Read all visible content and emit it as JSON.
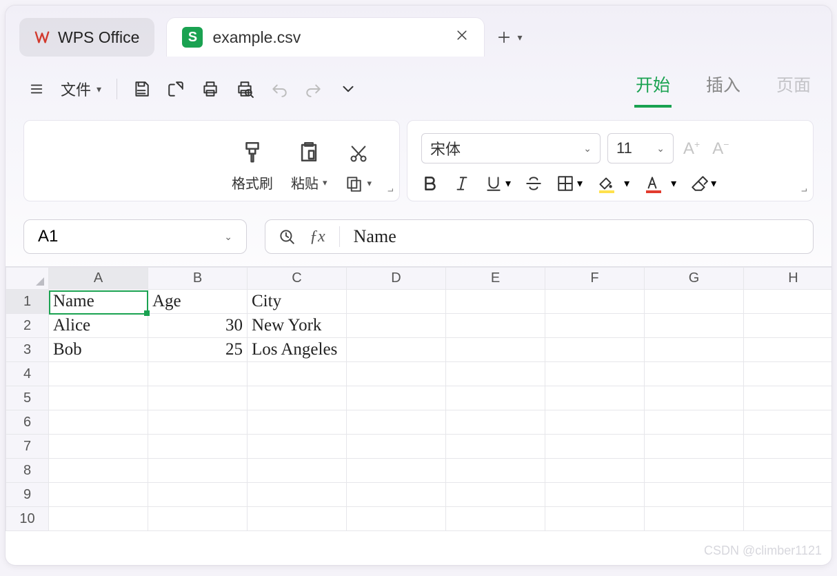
{
  "app": {
    "name": "WPS Office"
  },
  "tab": {
    "type_letter": "S",
    "filename": "example.csv"
  },
  "menu": {
    "file_label": "文件"
  },
  "ribbon_tabs": {
    "start": "开始",
    "insert": "插入",
    "page": "页面",
    "active": "start"
  },
  "ribbon": {
    "format_painter": "格式刷",
    "paste": "粘贴",
    "font_name": "宋体",
    "font_size": "11"
  },
  "namebox": {
    "value": "A1"
  },
  "formula": {
    "value": "Name"
  },
  "grid": {
    "columns": [
      "A",
      "B",
      "C",
      "D",
      "E",
      "F",
      "G",
      "H"
    ],
    "row_count": 10,
    "selected_cell": "A1",
    "rows": [
      {
        "A": "Name",
        "B": "Age",
        "C": "City"
      },
      {
        "A": "Alice",
        "B": 30,
        "C": "New York"
      },
      {
        "A": "Bob",
        "B": 25,
        "C": "Los Angeles"
      }
    ]
  },
  "watermark": "CSDN @climber1121"
}
